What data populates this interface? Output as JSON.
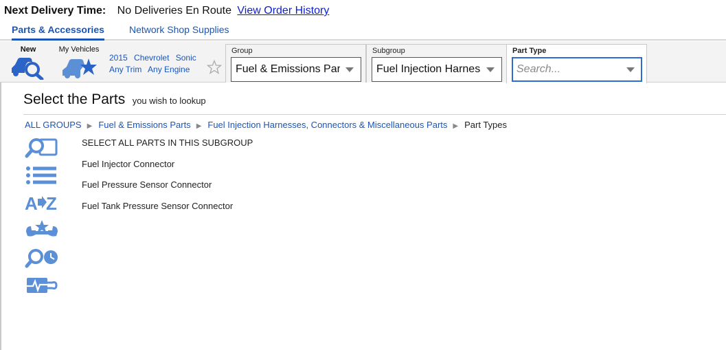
{
  "delivery": {
    "label": "Next Delivery Time:",
    "value": "No Deliveries En Route",
    "history_link": "View Order History"
  },
  "tabs": [
    {
      "label": "Parts & Accessories",
      "active": true
    },
    {
      "label": "Network Shop Supplies",
      "active": false
    }
  ],
  "toolbar": {
    "new_label": "New",
    "my_vehicles_label": "My Vehicles",
    "vehicle": {
      "year": "2015",
      "make": "Chevrolet",
      "model": "Sonic",
      "trim": "Any Trim",
      "engine": "Any Engine"
    },
    "group": {
      "label": "Group",
      "value": "Fuel & Emissions Parts"
    },
    "subgroup": {
      "label": "Subgroup",
      "value": "Fuel Injection Harnesses, Connectors & Miscellaneous Parts"
    },
    "part_type": {
      "label": "Part Type",
      "placeholder": "Search..."
    }
  },
  "page": {
    "title": "Select the Parts",
    "subtitle": "you wish to lookup"
  },
  "breadcrumb": [
    {
      "label": "ALL GROUPS",
      "link": true
    },
    {
      "label": "Fuel & Emissions Parts",
      "link": true
    },
    {
      "label": "Fuel Injection Harnesses, Connectors & Miscellaneous Parts",
      "link": true
    },
    {
      "label": "Part Types",
      "link": false
    }
  ],
  "side_icons": [
    "search-parts-icon",
    "list-icon",
    "a-to-z-icon",
    "tools-star-icon",
    "search-time-icon",
    "diagnostic-icon"
  ],
  "parts": [
    "SELECT ALL PARTS IN THIS SUBGROUP",
    "Fuel Injector Connector",
    "Fuel Pressure Sensor Connector",
    "Fuel Tank Pressure Sensor Connector"
  ],
  "colors": {
    "accent": "#1a55b8",
    "icon_blue": "#5b8fd6",
    "link": "#0c1fcc"
  }
}
